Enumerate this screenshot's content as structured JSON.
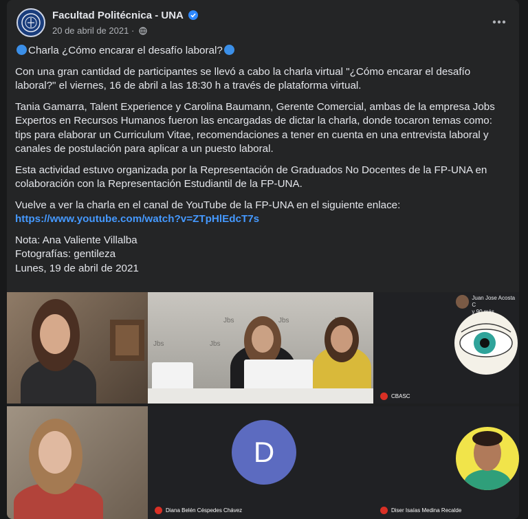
{
  "post": {
    "page_name": "Facultad Politécnica - UNA",
    "date": "20 de abril de 2021",
    "separator": "·",
    "title": "Charla ¿Cómo encarar el desafío laboral?",
    "paragraphs": [
      "Con una gran cantidad de participantes se llevó a cabo la charla virtual \"¿Cómo encarar el desafío laboral?\" el viernes, 16 de abril a las 18:30 h a través de plataforma virtual.",
      "Tania Gamarra, Talent Experience y Carolina Baumann, Gerente Comercial, ambas de la empresa Jobs Expertos en Recursos Humanos fueron las encargadas de dictar la charla, donde tocaron temas como: tips para elaborar un Curriculum Vitae, recomendaciones a tener en cuenta en una entrevista laboral y canales de postulación para aplicar a un puesto laboral.",
      "Esta actividad estuvo organizada por la Representación de Graduados No Docentes de la FP-UNA en colaboración con la Representación Estudiantil de la FP-UNA."
    ],
    "youtube_intro": "Vuelve a ver la charla en el canal de YouTube de la FP-UNA en el siguiente enlace:",
    "youtube_link": "https://www.youtube.com/watch?v=ZTpHlEdcT7s",
    "credits": [
      "Nota: Ana Valiente Villalba",
      "Fotografías: gentileza",
      "Lunes, 19 de abril de 2021"
    ]
  },
  "icons": {
    "verified": "verified-badge-icon",
    "privacy": "globe-icon",
    "more": "more-options-icon",
    "mic_muted": "mic-muted-icon"
  },
  "colors": {
    "link": "#4599ff",
    "card_bg": "#242526",
    "accent_dot": "#3b8fe8",
    "avatar_d": "#5c6bc0",
    "mic_red": "#d93025"
  },
  "meeting": {
    "participants": [
      {
        "name": "CBASC"
      },
      {
        "name": "Juan Jose Acosta C"
      },
      {
        "name": "Diana Belén Céspedes Chávez",
        "initial": "D"
      },
      {
        "name": "Diser Isaías Medina Recalde"
      }
    ],
    "others_count": "y 90 más",
    "wall_text": "Jbs"
  }
}
